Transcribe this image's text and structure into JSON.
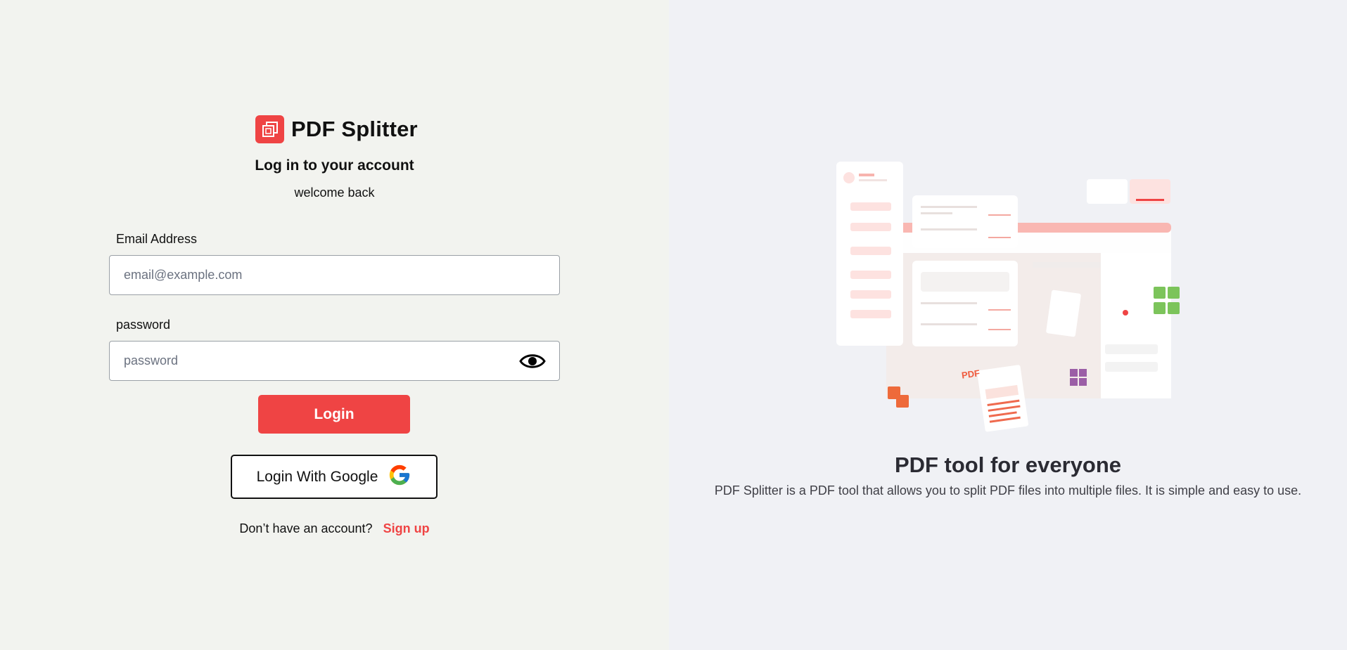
{
  "brand": {
    "name": "PDF Splitter",
    "logo_icon": "copy-pages-icon",
    "accent": "#ef4444"
  },
  "form": {
    "heading": "Log in to your account",
    "subheading": "welcome back",
    "email": {
      "label": "Email Address",
      "placeholder": "email@example.com",
      "value": ""
    },
    "password": {
      "label": "password",
      "placeholder": "password",
      "value": "",
      "toggle_icon": "eye-icon"
    },
    "login_button": "Login",
    "google_button": "Login With Google",
    "google_icon": "google-g-icon",
    "signup_prompt": "Don’t have an account?",
    "signup_link": "Sign up"
  },
  "promo": {
    "title": "PDF tool for everyone",
    "description": "PDF Splitter is a PDF tool that allows you to split PDF files into multiple files. It is simple and easy to use.",
    "illustration_badge": "PDF"
  },
  "colors": {
    "left_bg": "#f2f3ef",
    "right_bg": "#f0f1f5",
    "primary": "#ef4444"
  }
}
